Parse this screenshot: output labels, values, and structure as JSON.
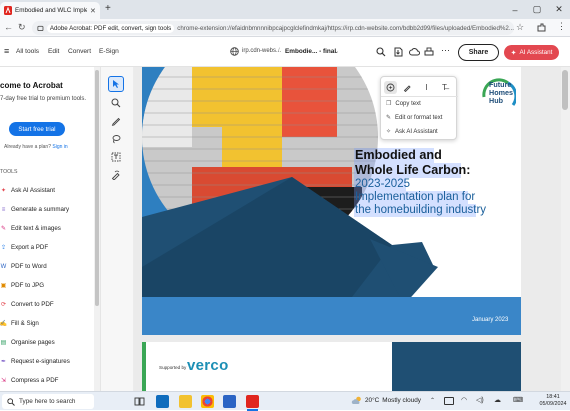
{
  "browser": {
    "tab_title": "Embodied and WLC Implemen",
    "new_tab": "+",
    "site_label": "Adobe Acrobat: PDF edit, convert, sign tools",
    "url": "chrome-extension://efaidnbmnnnibpcajpcglclefindmkaj/https://irp.cdn-website.com/bdbb2d99/files/uploaded/Embodied%2..."
  },
  "toolbar": {
    "tabs": [
      "All tools",
      "Edit",
      "Convert",
      "E-Sign"
    ],
    "domain": "irp.cdn-webs...",
    "separator": "/",
    "filename": "Embodie... - final",
    "share_label": "Share",
    "ai_label": "AI Assistant"
  },
  "left_panel": {
    "title": "come to Acrobat",
    "subtitle": "7-day free trial to premium tools.",
    "trial_button": "Start free trial",
    "already_text": "Already have a plan?",
    "sign_in": "Sign in",
    "tools_heading": "TOOLS",
    "tools": [
      {
        "label": "Ask AI Assistant",
        "icon": "ai-sparkle-icon",
        "color": "#e34850"
      },
      {
        "label": "Generate a summary",
        "icon": "summary-icon",
        "color": "#7b5cc7"
      },
      {
        "label": "Edit text & images",
        "icon": "edit-icon",
        "color": "#d6297a"
      },
      {
        "label": "Export a PDF",
        "icon": "export-icon",
        "color": "#1473e6"
      },
      {
        "label": "PDF to Word",
        "icon": "word-icon",
        "color": "#2b64c4"
      },
      {
        "label": "PDF to JPG",
        "icon": "jpg-icon",
        "color": "#e08a00"
      },
      {
        "label": "Convert to PDF",
        "icon": "convert-icon",
        "color": "#e34850"
      },
      {
        "label": "Fill & Sign",
        "icon": "sign-icon",
        "color": "#7b5cc7"
      },
      {
        "label": "Organise pages",
        "icon": "organise-icon",
        "color": "#2d9d5e"
      },
      {
        "label": "Request e-signatures",
        "icon": "esign-icon",
        "color": "#7b5cc7"
      },
      {
        "label": "Compress a PDF",
        "icon": "compress-icon",
        "color": "#d6297a"
      }
    ]
  },
  "context_menu": {
    "items": [
      "Copy text",
      "Edit or format text",
      "Ask AI Assistant"
    ]
  },
  "document": {
    "heading_line1": "Embodied and",
    "heading_line2": "Whole Life Carbon:",
    "sub_line1": "2023-2025",
    "sub_line2": "Implementation plan for",
    "sub_line3": "the homebuilding industry",
    "date": "January 2023",
    "logo_line1": "Future",
    "logo_line2": "Homes",
    "logo_line3": "Hub",
    "supported_by": "Supported by",
    "sponsor": "verco"
  },
  "taskbar": {
    "search_placeholder": "Type here to search",
    "weather_temp": "20°C",
    "weather_text": "Mostly cloudy",
    "time": "18:41",
    "date": "05/09/2024"
  },
  "colors": {
    "accent": "#1473e6",
    "ai_red": "#e34850",
    "doc_blue": "#3a86c8"
  }
}
